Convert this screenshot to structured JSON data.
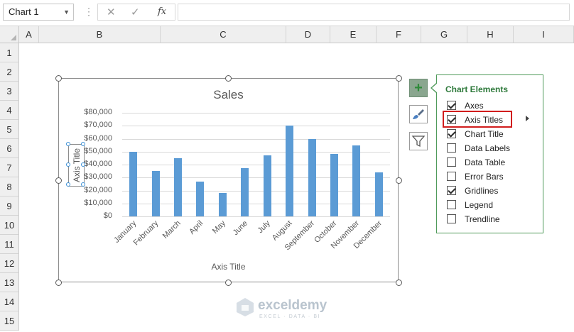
{
  "formula_bar": {
    "name_box": "Chart 1",
    "cancel_icon": "✕",
    "enter_icon": "✓",
    "function_label": "fx",
    "formula_value": ""
  },
  "columns": [
    "A",
    "B",
    "C",
    "D",
    "E",
    "F",
    "G",
    "H",
    "I"
  ],
  "rows": [
    "1",
    "2",
    "3",
    "4",
    "5",
    "6",
    "7",
    "8",
    "9",
    "10",
    "11",
    "12",
    "13",
    "14",
    "15"
  ],
  "chart_data": {
    "type": "bar",
    "title": "Sales",
    "categories": [
      "January",
      "February",
      "March",
      "April",
      "May",
      "June",
      "July",
      "August",
      "September",
      "October",
      "November",
      "December"
    ],
    "values": [
      50000,
      35000,
      45000,
      27000,
      18000,
      37000,
      47000,
      70000,
      60000,
      48000,
      55000,
      34000
    ],
    "xlabel": "Axis Title",
    "ylabel": "Axis Title",
    "ylim": [
      0,
      80000
    ],
    "yticks": [
      "$80,000",
      "$70,000",
      "$60,000",
      "$50,000",
      "$40,000",
      "$30,000",
      "$20,000",
      "$10,000",
      "$0"
    ],
    "grid": true,
    "legend": "none",
    "bar_color": "#5b9bd5"
  },
  "chart_elements_panel": {
    "title": "Chart Elements",
    "items": [
      {
        "label": "Axes",
        "checked": true
      },
      {
        "label": "Axis Titles",
        "checked": true
      },
      {
        "label": "Chart Title",
        "checked": true
      },
      {
        "label": "Data Labels",
        "checked": false
      },
      {
        "label": "Data Table",
        "checked": false
      },
      {
        "label": "Error Bars",
        "checked": false
      },
      {
        "label": "Gridlines",
        "checked": true
      },
      {
        "label": "Legend",
        "checked": false
      },
      {
        "label": "Trendline",
        "checked": false
      }
    ]
  },
  "side_buttons": [
    "plus-icon",
    "brush-icon",
    "filter-icon"
  ],
  "watermark": {
    "name": "exceldemy",
    "tagline": "EXCEL · DATA · BI"
  }
}
